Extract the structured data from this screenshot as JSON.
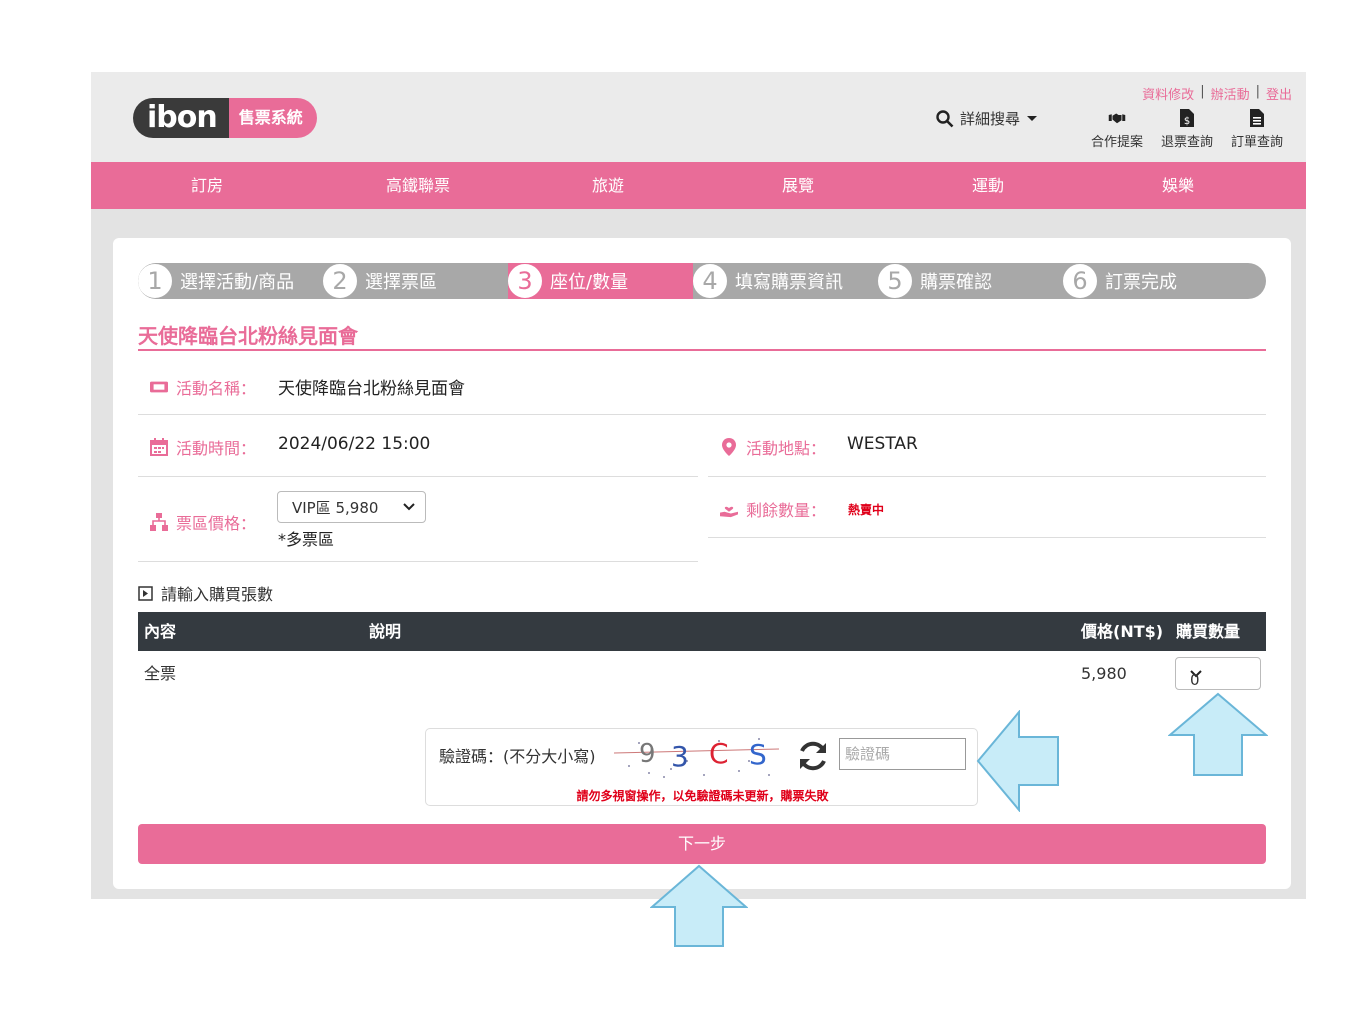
{
  "header": {
    "logo_main": "ibon",
    "logo_sub": "售票系統",
    "search_label": "詳細搜尋",
    "top_links": [
      "資料修改",
      "辦活動",
      "登出"
    ],
    "top_icons": [
      {
        "label": "合作提案",
        "icon": "handshake-icon"
      },
      {
        "label": "退票查詢",
        "icon": "refund-document-icon"
      },
      {
        "label": "訂單查詢",
        "icon": "order-document-icon"
      }
    ]
  },
  "nav": [
    "訂房",
    "高鐵聯票",
    "旅遊",
    "展覽",
    "運動",
    "娛樂"
  ],
  "steps": [
    {
      "num": "1",
      "label": "選擇活動/商品",
      "active": false
    },
    {
      "num": "2",
      "label": "選擇票區",
      "active": false
    },
    {
      "num": "3",
      "label": "座位/數量",
      "active": true
    },
    {
      "num": "4",
      "label": "填寫購票資訊",
      "active": false
    },
    {
      "num": "5",
      "label": "購票確認",
      "active": false
    },
    {
      "num": "6",
      "label": "訂票完成",
      "active": false
    }
  ],
  "event": {
    "title": "天使降臨台北粉絲見面會",
    "name_label": "活動名稱：",
    "name_value": "天使降臨台北粉絲見面會",
    "time_label": "活動時間：",
    "time_value": "2024/06/22  15:00",
    "venue_label": "活動地點：",
    "venue_value": "WESTAR",
    "price_label": "票區價格：",
    "price_select": "VIP區 5,980",
    "price_note": "*多票區",
    "remain_label": "剩餘數量：",
    "remain_value": "熱賣中"
  },
  "quantity": {
    "heading": "請輸入購買張數",
    "columns": [
      "內容",
      "說明",
      "價格(NT$)",
      "購買數量"
    ],
    "rows": [
      {
        "content": "全票",
        "desc": "",
        "price": "5,980",
        "qty": "0"
      }
    ]
  },
  "captcha": {
    "label": "驗證碼：(不分大小寫)",
    "code": "9 3 C S",
    "placeholder": "驗證碼",
    "warning": "請勿多視窗操作，以免驗證碼未更新，購票失敗"
  },
  "next_button": "下一步",
  "colors": {
    "brand_pink": "#e96c98",
    "dark": "#343a40",
    "arrow_fill": "#c8ecf8",
    "arrow_stroke": "#6ab6d8"
  }
}
